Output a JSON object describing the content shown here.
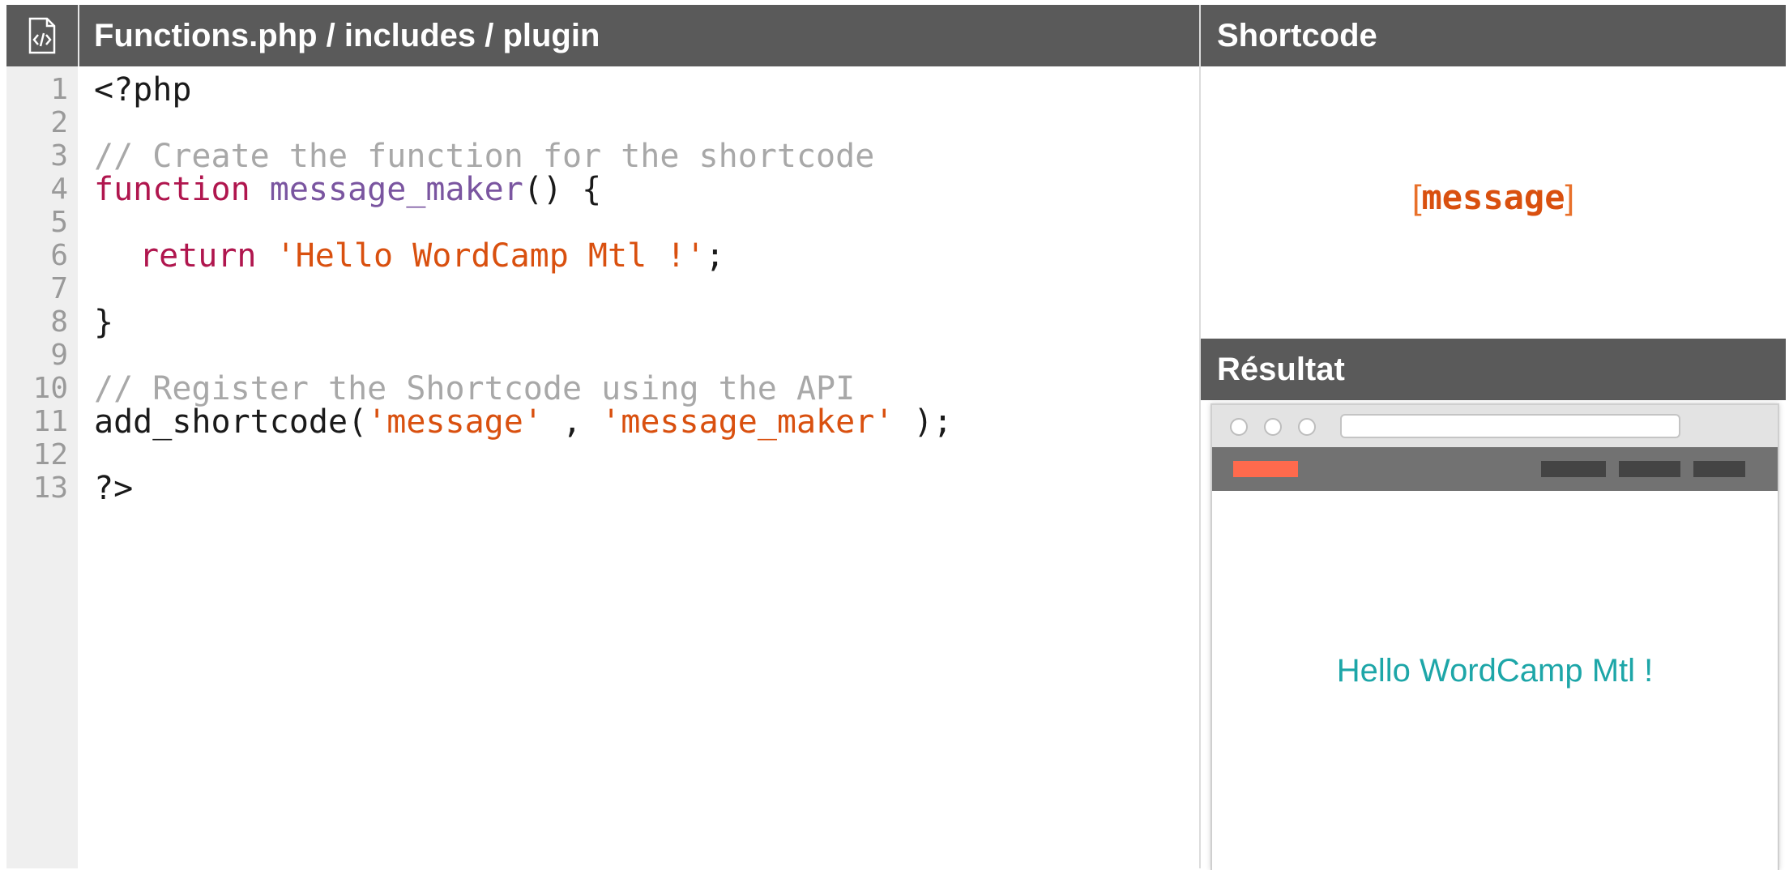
{
  "editor": {
    "title": "Functions.php / includes / plugin",
    "icon": "code-file-icon",
    "line_numbers": [
      "1",
      "2",
      "3",
      "4",
      "5",
      "6",
      "7",
      "8",
      "9",
      "10",
      "11",
      "12",
      "13"
    ],
    "lines": {
      "l1": "<?php",
      "l3_comment": "// Create the function for the shortcode",
      "l4_keyword": "function",
      "l4_fn": "message_maker",
      "l4_rest": "() {",
      "l6_keyword": "return",
      "l6_string": "'Hello WordCamp Mtl !'",
      "l6_rest": ";",
      "l8": "}",
      "l10_comment": "// Register the Shortcode using the API",
      "l11_call": "add_shortcode(",
      "l11_arg1": "'message'",
      "l11_sep": " , ",
      "l11_arg2": "'message_maker'",
      "l11_end": " );",
      "l13": "?>"
    }
  },
  "shortcode_panel": {
    "header": "Shortcode",
    "open_bracket": "[",
    "tag": "message",
    "close_bracket": "]"
  },
  "result_panel": {
    "header": "Résultat",
    "output": "Hello WordCamp Mtl !"
  },
  "colors": {
    "header_bg": "#5a5a5a",
    "comment": "#a8a8a8",
    "keyword": "#b0164e",
    "function_name": "#7a55a0",
    "string": "#d9500f",
    "result_text": "#1da6a8",
    "browser_logo": "#ff6a4d"
  }
}
